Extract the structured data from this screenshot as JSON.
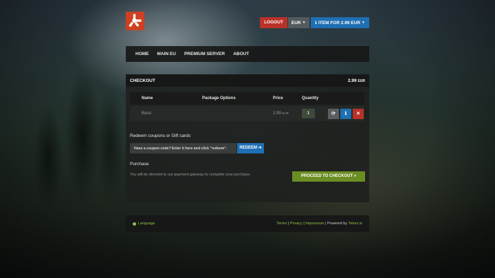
{
  "header": {
    "logout_label": "LOGOUT",
    "currency_label": "EUR",
    "basket_label": "1 ITEM FOR 2.99 EUR"
  },
  "nav": {
    "items": [
      {
        "label": "HOME"
      },
      {
        "label": "MAIN EU"
      },
      {
        "label": "PREMIUM SERVER"
      },
      {
        "label": "ABOUT"
      }
    ]
  },
  "checkout": {
    "title": "CHECKOUT",
    "total_amount": "2.99",
    "total_currency": "EUR",
    "columns": {
      "name": "Name",
      "options": "Package Options",
      "price": "Price",
      "quantity": "Quantity"
    },
    "rows": [
      {
        "name": "Basic",
        "price_amount": "2.99",
        "price_currency": "EUR",
        "quantity": "1"
      }
    ],
    "coupon": {
      "title": "Redeem coupons or Gift cards",
      "placeholder": "Have a coupon code? Enter it here and click \"redeem\".",
      "redeem_label": "REDEEM"
    },
    "purchase": {
      "title": "Purchase",
      "note": "You will be directed to our payment gateway to complete your purchase.",
      "checkout_label": "PROCEED TO CHECKOUT"
    }
  },
  "footer": {
    "language_label": "Language",
    "terms": "Terms",
    "privacy": "Privacy",
    "impressum": "Impressum",
    "powered_prefix": "Powered by",
    "powered_brand": "Tebex.io"
  },
  "icons": {
    "logo": "rust-logo-icon",
    "update": "refresh-icon",
    "info": "info-icon",
    "remove": "close-icon",
    "language": "globe-icon"
  },
  "colors": {
    "logo": "#ce4022",
    "logout": "#b9322a",
    "basket": "#1f6fb3",
    "checkout": "#6b8e23",
    "link": "#8fc04a"
  }
}
